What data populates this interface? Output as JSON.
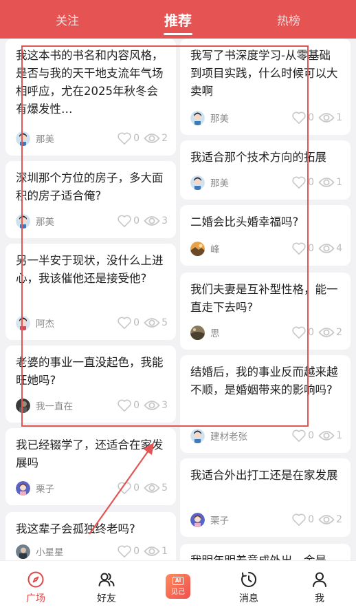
{
  "tabs": {
    "follow": "关注",
    "recommend": "推荐",
    "hot": "热榜"
  },
  "left_cards": [
    {
      "title": "我这本书的书名和内容风格，是否与我的天干地支流年气场相呼应，尤在2025年秋冬会有爆发性…",
      "author": "那美",
      "likes": "0",
      "views": "2"
    },
    {
      "title": "深圳那个方位的房子，多大面积的房子适合俺?",
      "author": "那美",
      "likes": "0",
      "views": "3"
    },
    {
      "title": "另一半安于现状，没什么上进心，我该催他还是接受他?",
      "author": "阿杰",
      "likes": "0",
      "views": "5"
    },
    {
      "title": "老婆的事业一直没起色，我能旺她吗?",
      "author": "我一直在",
      "likes": "0",
      "views": "3"
    },
    {
      "title": "我已经辍学了，还适合在家发展吗",
      "author": "栗子",
      "likes": "0",
      "views": "5"
    },
    {
      "title": "我这辈子会孤独终老吗?",
      "author": "小星星",
      "likes": "0",
      "views": "1"
    }
  ],
  "right_cards": [
    {
      "title": "我写了书深度学习-从零基础到项目实践，什么时候可以大卖啊",
      "author": "那美",
      "likes": "0",
      "views": "1"
    },
    {
      "title": "我适合那个技术方向的拓展",
      "author": "那美",
      "likes": "0",
      "views": "1"
    },
    {
      "title": "二婚会比头婚幸福吗?",
      "author": "峰",
      "likes": "0",
      "views": "4"
    },
    {
      "title": "我们夫妻是互补型性格，能一直走下去吗?",
      "author": "思",
      "likes": "0",
      "views": "2"
    },
    {
      "title": "结婚后，我的事业反而越来越不顺，是婚姻带来的影响吗?",
      "author": "建材老张",
      "likes": "0",
      "views": "1"
    },
    {
      "title": "我适合外出打工还是在家发展",
      "author": "栗子",
      "likes": "0",
      "views": "2"
    },
    {
      "title": "我明年明着意成外出，金是",
      "author": "",
      "likes": "",
      "views": ""
    }
  ],
  "bottom_nav": {
    "square": "广场",
    "friends": "好友",
    "ai_icon_text": "AI",
    "ai_label": "见己",
    "messages": "消息",
    "me": "我"
  },
  "colors": {
    "brand_red": "#e65353",
    "active_red": "#e14545"
  }
}
